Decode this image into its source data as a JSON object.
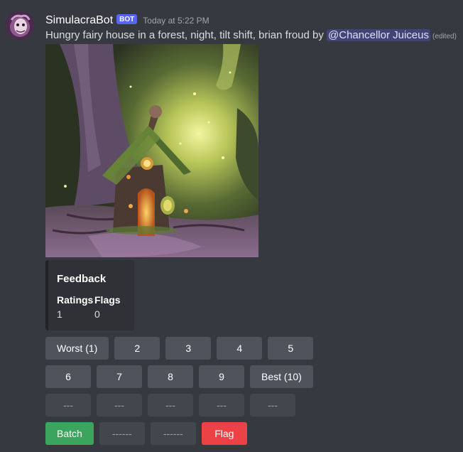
{
  "message": {
    "author": "SimulacraBot",
    "bot_tag": "BOT",
    "timestamp": "Today at 5:22 PM",
    "content_text": "Hungry fairy house in a forest, night, tilt shift, brian froud by ",
    "mention": "@Chancellor Juiceus",
    "edited_label": "(edited)",
    "avatar_icon": "avatar-image"
  },
  "attachment": {
    "kind": "generated-image",
    "subject": "fairy house in forest at night"
  },
  "embed": {
    "title": "Feedback",
    "fields": [
      {
        "name": "Ratings",
        "value": "1"
      },
      {
        "name": "Flags",
        "value": "0"
      }
    ]
  },
  "buttons": {
    "row1": [
      "Worst (1)",
      "2",
      "3",
      "4",
      "5"
    ],
    "row2": [
      "6",
      "7",
      "8",
      "9",
      "Best (10)"
    ],
    "row3": [
      "---",
      "---",
      "---",
      "---",
      "---"
    ],
    "row4": {
      "batch": "Batch",
      "spacer1": "------",
      "spacer2": "------",
      "flag": "Flag"
    }
  },
  "colors": {
    "background": "#36393f",
    "button_secondary": "#4f545c",
    "button_success": "#3ba55d",
    "button_danger": "#ed4245",
    "bot_tag": "#5865f2",
    "embed_background": "#2f3136"
  }
}
